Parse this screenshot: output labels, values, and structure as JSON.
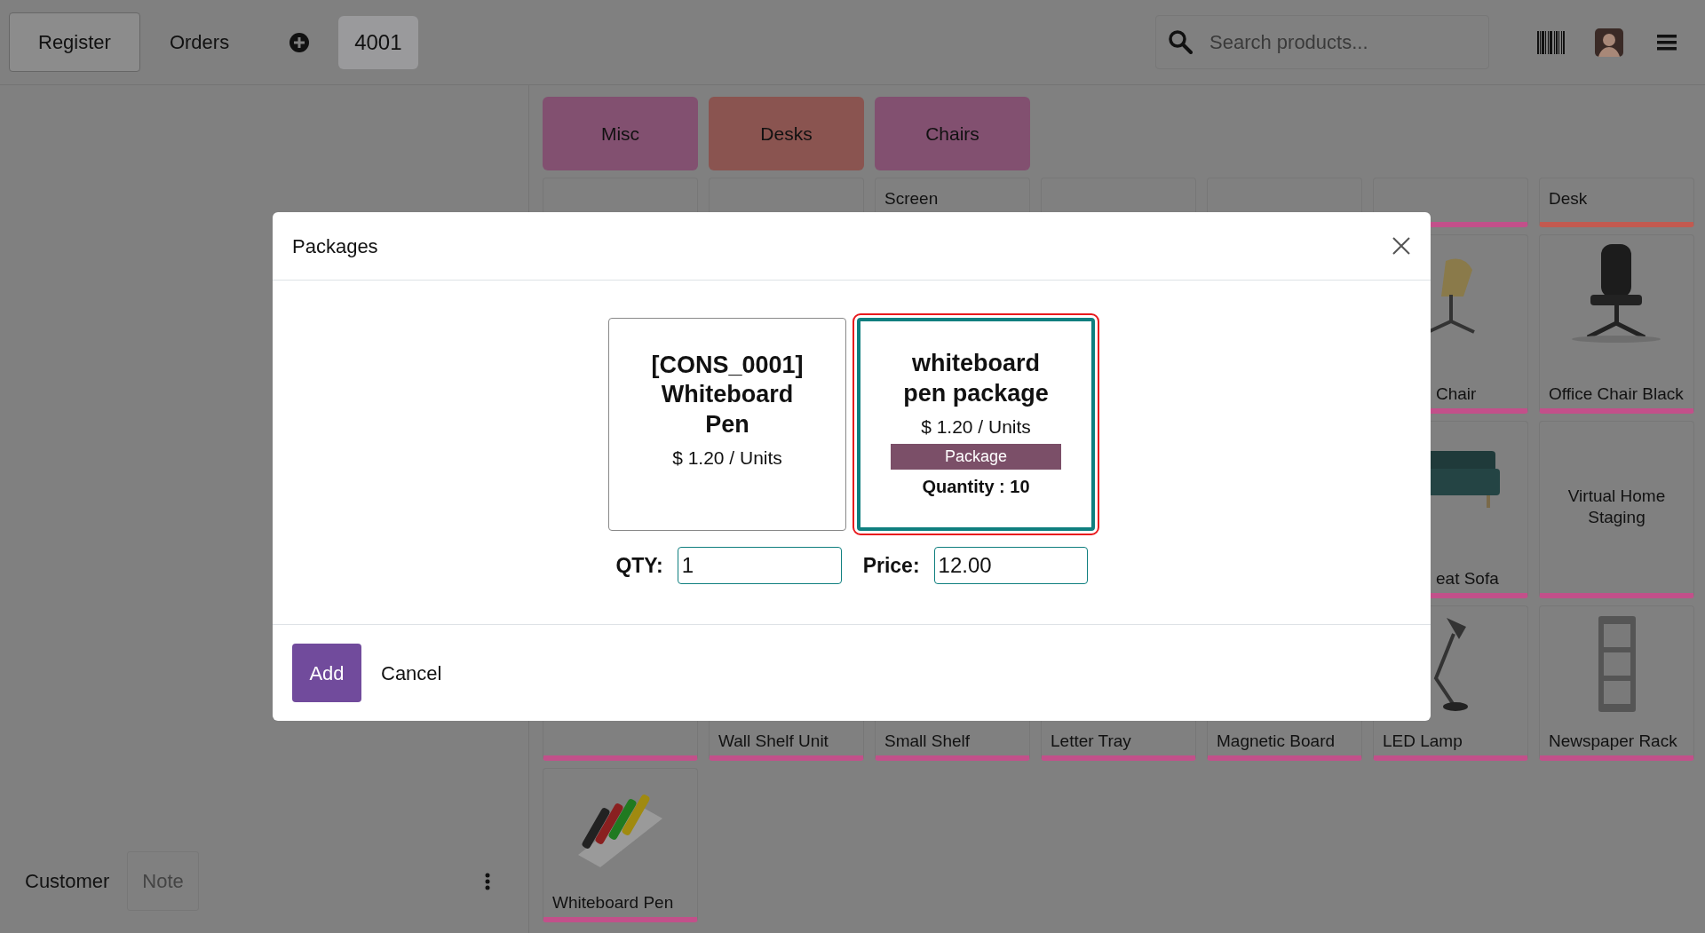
{
  "topbar": {
    "tabs": [
      {
        "label": "Register",
        "selected": true
      },
      {
        "label": "Orders",
        "selected": false
      }
    ],
    "order_tabs": [
      {
        "label": "4001",
        "selected": true
      }
    ],
    "search": {
      "placeholder": "Search products..."
    }
  },
  "order_panel": {
    "buttons": [
      {
        "label": "Customer",
        "kind": "plain"
      },
      {
        "label": "Note",
        "kind": "muted"
      }
    ]
  },
  "categories": [
    {
      "label": "Misc",
      "color": "#825070"
    },
    {
      "label": "Desks",
      "color": "#8a5450"
    },
    {
      "label": "Chairs",
      "color": "#825070"
    }
  ],
  "product_rows": [
    [
      {
        "kind": "stub"
      },
      {
        "kind": "stub"
      },
      {
        "kind": "stub",
        "name": "Screen"
      },
      {
        "kind": "stub"
      },
      {
        "kind": "stub"
      },
      {
        "kind": "stub",
        "color": "#c2508a"
      },
      {
        "kind": "stub",
        "name": "Desk",
        "color": "#c25a50"
      }
    ],
    [
      {
        "kind": "hidden"
      },
      {
        "kind": "hidden"
      },
      {
        "kind": "hidden"
      },
      {
        "kind": "hidden"
      },
      {
        "kind": "hidden"
      },
      {
        "kind": "chair",
        "name": "Chair",
        "clipped": true,
        "color": "#c2508a"
      },
      {
        "kind": "officechair",
        "name": "Office Chair Black",
        "color": "#c2508a"
      }
    ],
    [
      {
        "kind": "hidden"
      },
      {
        "kind": "hidden"
      },
      {
        "kind": "hidden"
      },
      {
        "kind": "hidden"
      },
      {
        "kind": "hidden"
      },
      {
        "kind": "sofa",
        "name": "eat Sofa",
        "clipped": true,
        "color": "#c2508a"
      },
      {
        "kind": "plain",
        "name": "Virtual Home Staging",
        "color": "#c2508a"
      }
    ],
    [
      {
        "kind": "bottom",
        "color": "#c2508a"
      },
      {
        "kind": "bottom",
        "name": "Wall Shelf Unit",
        "color": "#c2508a"
      },
      {
        "kind": "bottom",
        "name": "Small Shelf",
        "color": "#c2508a"
      },
      {
        "kind": "bottom",
        "name": "Letter Tray",
        "color": "#c2508a"
      },
      {
        "kind": "bottom",
        "name": "Magnetic Board",
        "color": "#c2508a"
      },
      {
        "kind": "lamp",
        "name": "LED Lamp",
        "color": "#c2508a"
      },
      {
        "kind": "rack",
        "name": "Newspaper Rack",
        "color": "#c2508a"
      }
    ],
    [
      {
        "kind": "pens",
        "name": "Whiteboard Pen",
        "color": "#c2508a"
      }
    ]
  ],
  "dialog": {
    "title": "Packages",
    "options": [
      {
        "title": "[CONS_0001] Whiteboard Pen",
        "price": "$ 1.20 / Units",
        "selected": false
      },
      {
        "title": "whiteboard pen package",
        "price": "$ 1.20 / Units",
        "badge": "Package",
        "quantity": "Quantity : 10",
        "selected": true
      }
    ],
    "fields": [
      {
        "label": "QTY:",
        "value": "1"
      },
      {
        "label": "Price:",
        "value": "12.00"
      }
    ],
    "buttons": [
      {
        "label": "Add",
        "kind": "primary"
      },
      {
        "label": "Cancel",
        "kind": "secondary"
      }
    ]
  }
}
